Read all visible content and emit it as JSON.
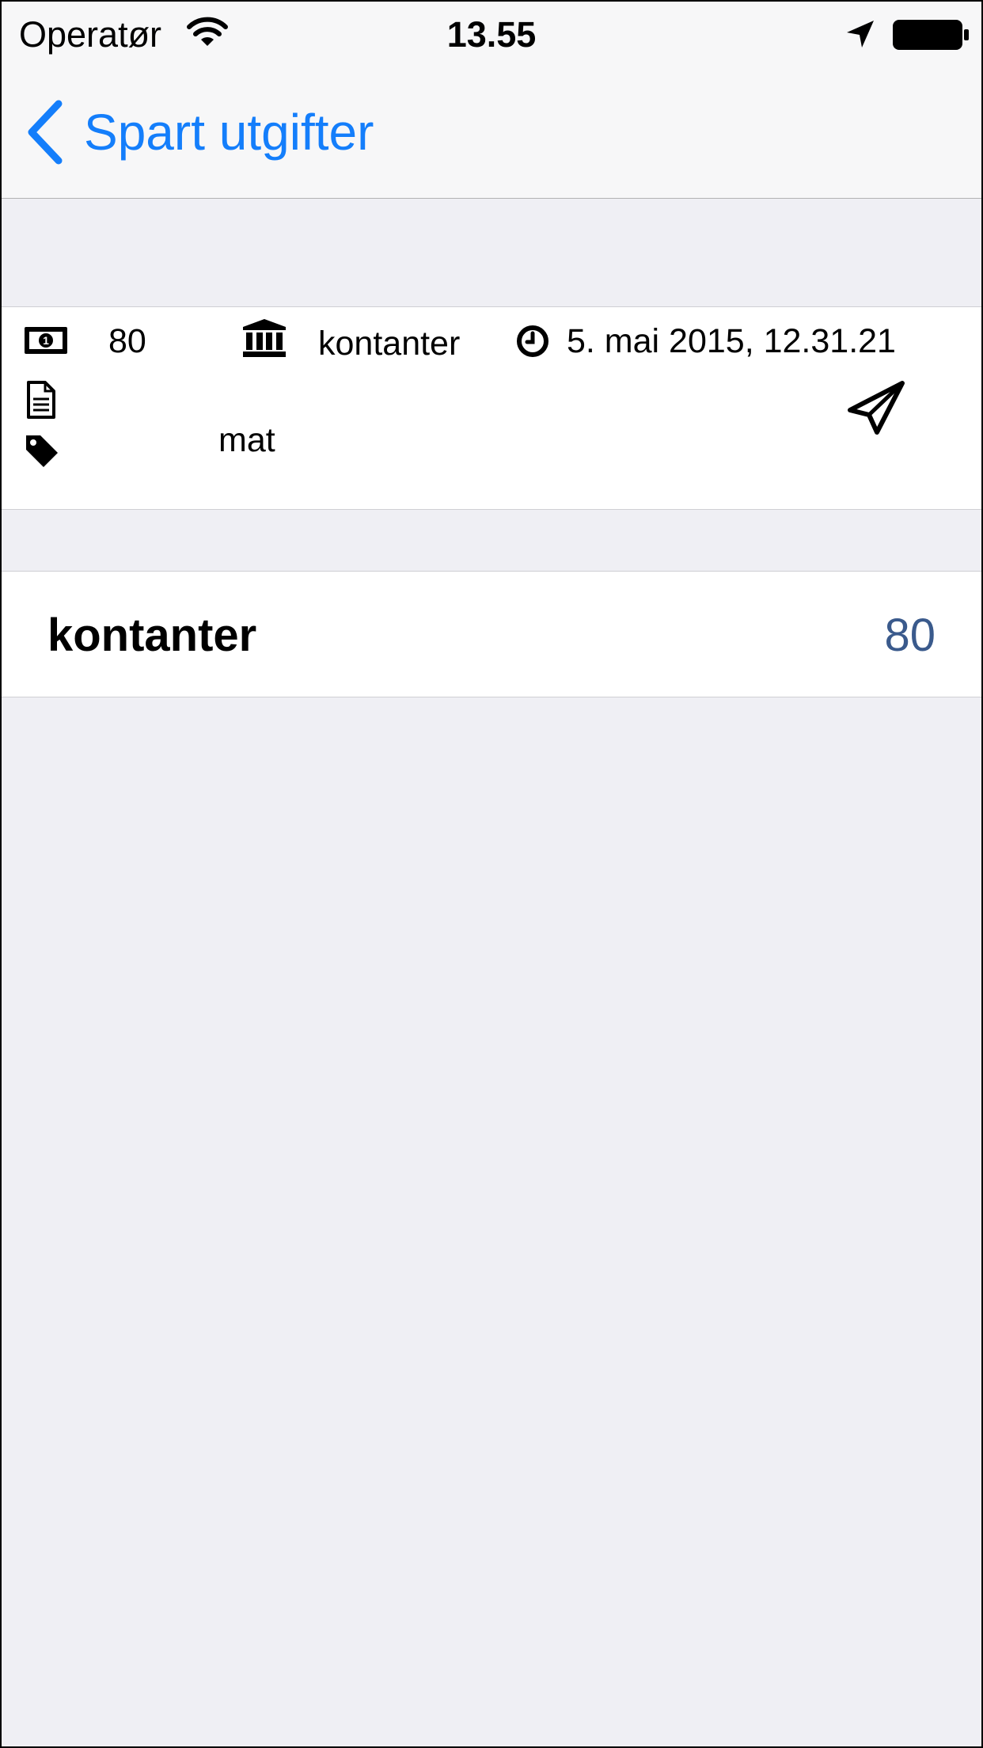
{
  "status_bar": {
    "carrier": "Operatør",
    "time": "13.55"
  },
  "nav": {
    "back_label": "Spart utgifter"
  },
  "transaction": {
    "amount": "80",
    "account": "kontanter",
    "datetime": "5. mai 2015, 12.31.21",
    "note": "",
    "tag": "mat",
    "icons": {
      "amount": "money-bill-icon",
      "account": "bank-icon",
      "datetime": "clock-icon",
      "note": "document-icon",
      "tag": "tag-icon",
      "send": "paper-plane-icon"
    }
  },
  "summary": {
    "label": "kontanter",
    "value": "80"
  },
  "colors": {
    "accent": "#147efb",
    "value": "#3a5a8c",
    "background": "#efeff4"
  }
}
